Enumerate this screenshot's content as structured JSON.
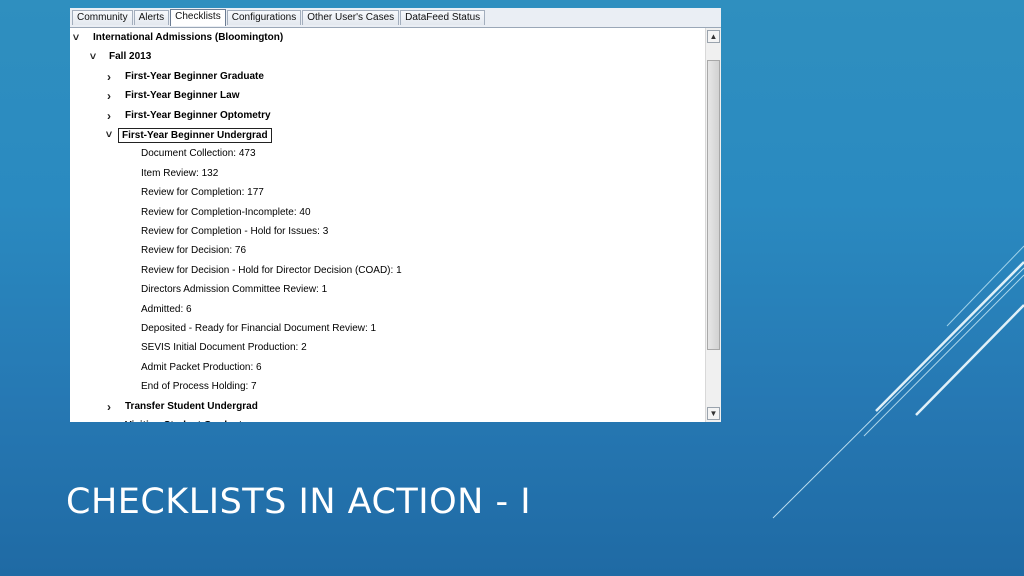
{
  "tabs": [
    {
      "label": "Community",
      "active": false
    },
    {
      "label": "Alerts",
      "active": false
    },
    {
      "label": "Checklists",
      "active": true
    },
    {
      "label": "Configurations",
      "active": false
    },
    {
      "label": "Other User's Cases",
      "active": false
    },
    {
      "label": "DataFeed Status",
      "active": false
    }
  ],
  "tree": {
    "root": {
      "label": "International Admissions (Bloomington)",
      "expanded": true
    },
    "term": {
      "label": "Fall 2013",
      "expanded": true
    },
    "programs_before": [
      {
        "label": "First-Year Beginner Graduate",
        "expanded": false
      },
      {
        "label": "First-Year Beginner Law",
        "expanded": false
      },
      {
        "label": "First-Year Beginner Optometry",
        "expanded": false
      }
    ],
    "selected_program": {
      "label": "First-Year Beginner Undergrad",
      "expanded": true
    },
    "checklist_items": [
      "Document Collection: 473",
      "Item Review: 132",
      "Review for Completion: 177",
      "Review for Completion-Incomplete: 40",
      "Review for Completion - Hold for Issues: 3",
      "Review for Decision: 76",
      "Review for Decision - Hold for Director Decision (COAD): 1",
      "Directors Admission Committee Review: 1",
      "Admitted: 6",
      "Deposited - Ready for Financial Document Review: 1",
      "SEVIS Initial Document Production: 2",
      "Admit Packet Production: 6",
      "End of Process Holding: 7"
    ],
    "programs_after": [
      {
        "label": "Transfer Student Undergrad",
        "expanded": false
      },
      {
        "label": "Visiting Student Graduate",
        "expanded": false
      }
    ]
  },
  "icons": {
    "expanded": "chevron-down-icon",
    "collapsed": "chevron-right-icon"
  },
  "slide": {
    "title": "CHECKLISTS IN ACTION - I"
  },
  "colors": {
    "background": "#2a85bd",
    "title_text": "#ffffff",
    "window": "#ffffff"
  }
}
